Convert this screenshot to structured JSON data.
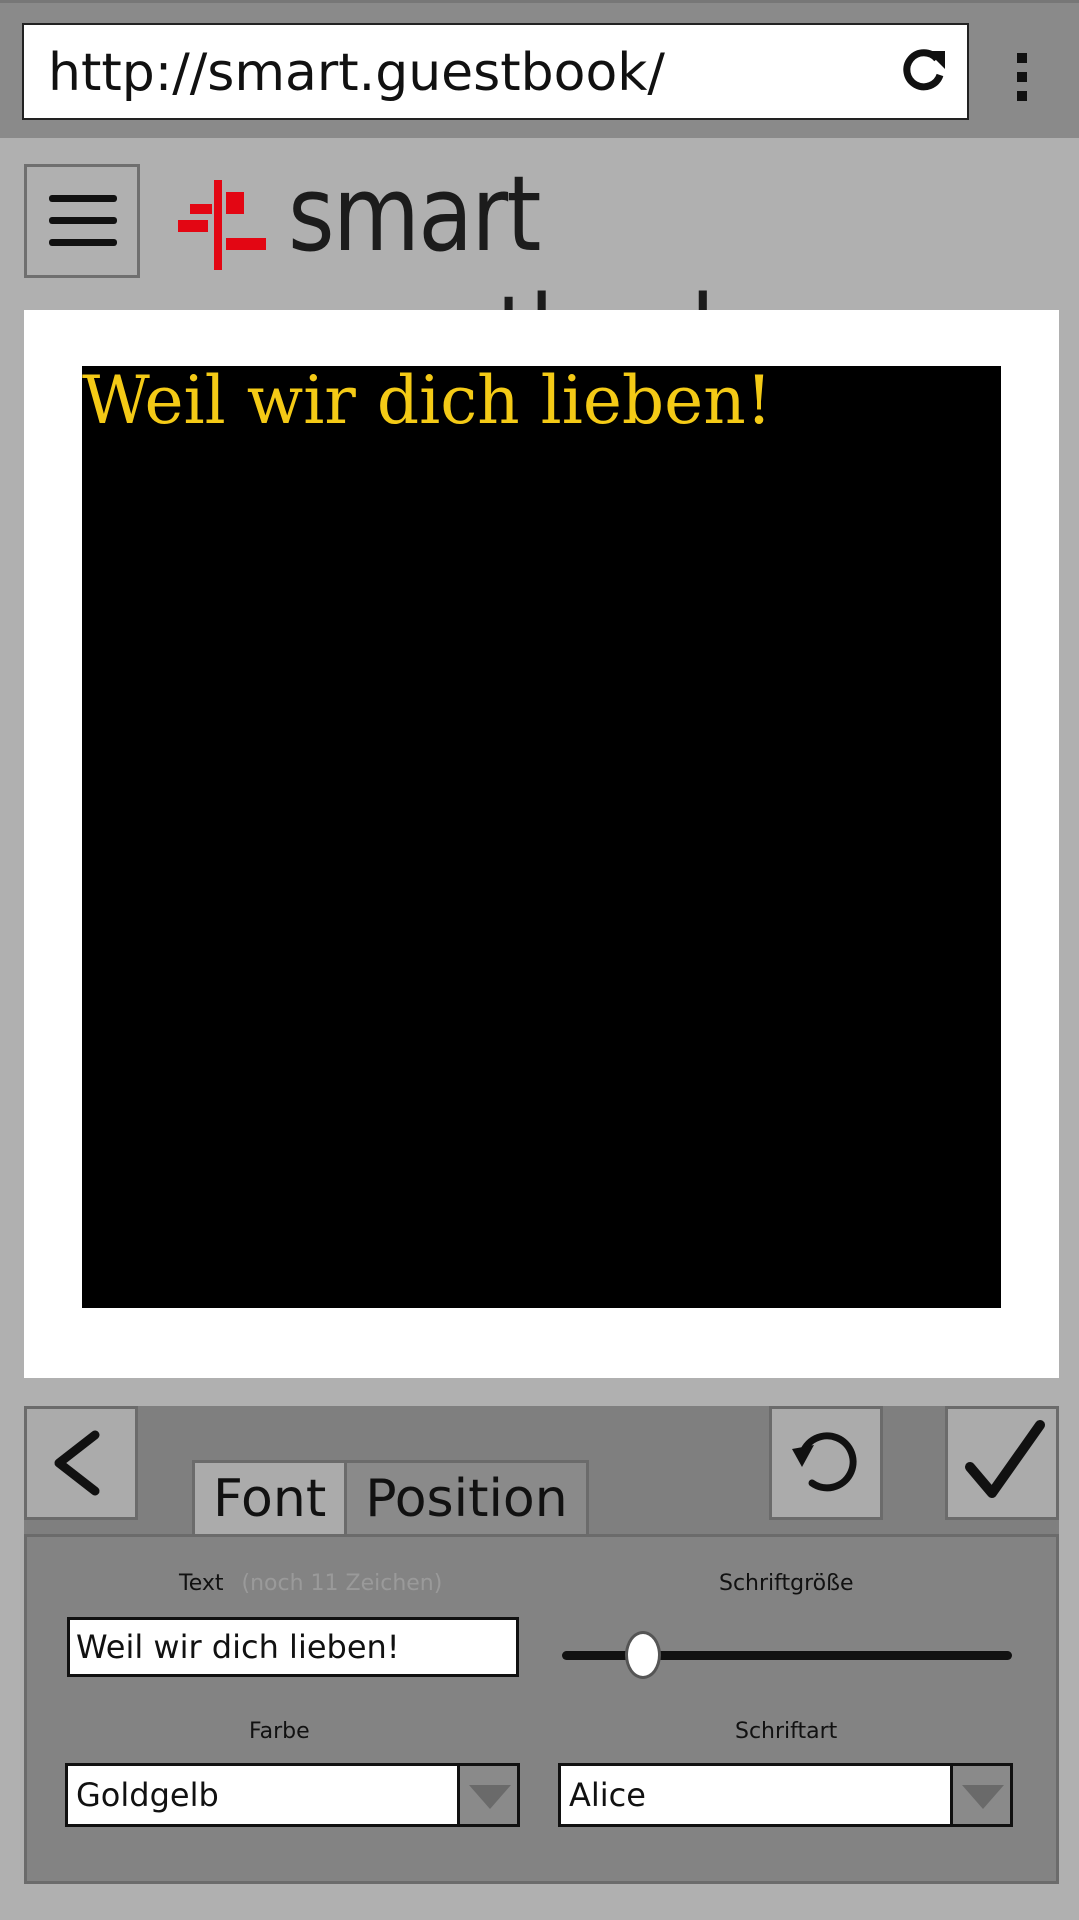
{
  "browser": {
    "url": "http://smart.guestbook/"
  },
  "app": {
    "title": "smart guestbook"
  },
  "preview": {
    "text": "Weil wir dich lieben!",
    "text_color": "#f4ca16",
    "background": "#000000"
  },
  "tabs": [
    {
      "label": "Font",
      "active": true
    },
    {
      "label": "Position",
      "active": false
    }
  ],
  "form": {
    "text_label": "Text",
    "text_hint": "(noch 11 Zeichen)",
    "text_value": "Weil wir dich lieben!",
    "size_label": "Schriftgröße",
    "size_level": 0.18,
    "color_label": "Farbe",
    "color_value": "Goldgelb",
    "font_label": "Schriftart",
    "font_value": "Alice"
  },
  "icons": [
    "reload-icon",
    "overflow-menu-icon",
    "hamburger-icon",
    "back-arrow-icon",
    "undo-icon",
    "checkmark-icon",
    "dropdown-arrow-icon"
  ],
  "colors": {
    "brand_red": "#e30613",
    "panel_gray": "#7f7f7f",
    "page_gray": "#b0b0b0"
  }
}
